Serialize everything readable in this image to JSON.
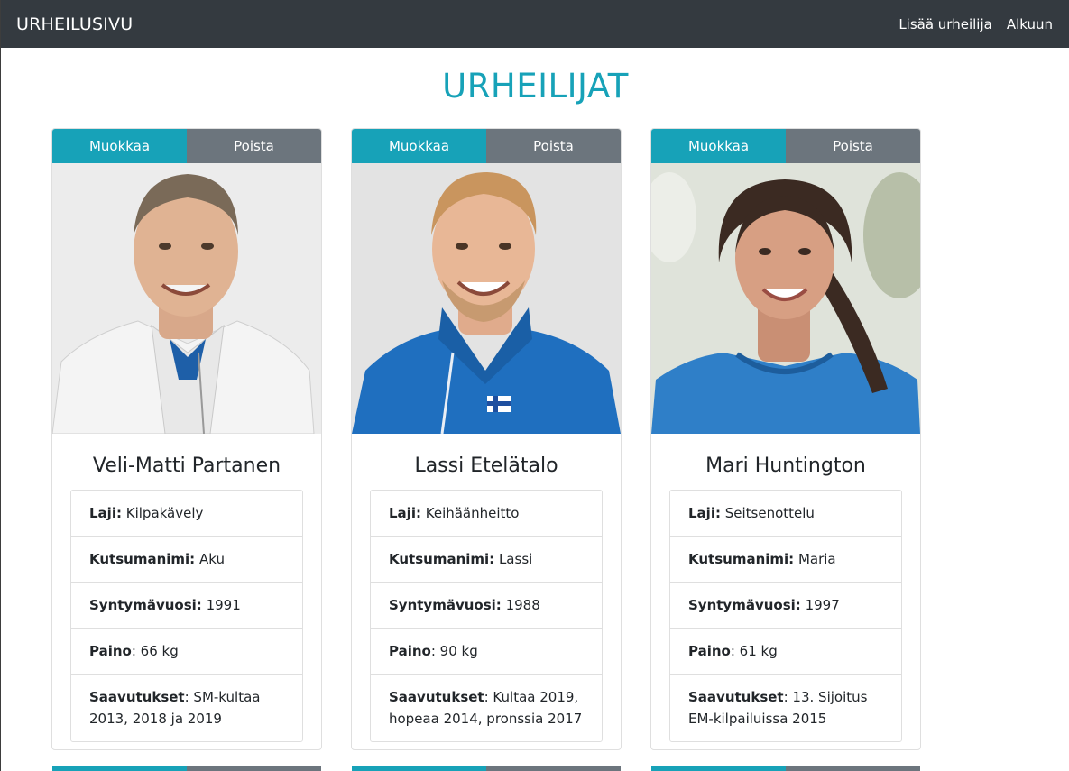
{
  "navbar": {
    "brand": "URHEILUSIVU",
    "links": [
      "Lisää urheilija",
      "Alkuun"
    ]
  },
  "page_title": "URHEILIJAT",
  "athletes": [
    {
      "edit_label": "Muokkaa",
      "delete_label": "Poista",
      "name": "Veli-Matti Partanen",
      "laji_label": "Laji:",
      "laji": "Kilpakävely",
      "kutsumanimi_label": "Kutsumanimi:",
      "kutsumanimi": "Aku",
      "syntymavuosi_label": "Syntymävuosi:",
      "syntymavuosi": "1991",
      "paino_label": "Paino",
      "paino": ": 66 kg",
      "saavutukset_label": "Saavutukset",
      "saavutukset": ": SM-kultaa 2013, 2018 ja 2019"
    },
    {
      "edit_label": "Muokkaa",
      "delete_label": "Poista",
      "name": "Lassi Etelätalo",
      "laji_label": "Laji:",
      "laji": "Keihäänheitto",
      "kutsumanimi_label": "Kutsumanimi:",
      "kutsumanimi": "Lassi",
      "syntymavuosi_label": "Syntymävuosi:",
      "syntymavuosi": "1988",
      "paino_label": "Paino",
      "paino": ": 90 kg",
      "saavutukset_label": "Saavutukset",
      "saavutukset": ": Kultaa 2019, hopeaa 2014, pronssia 2017"
    },
    {
      "edit_label": "Muokkaa",
      "delete_label": "Poista",
      "name": "Mari Huntington",
      "laji_label": "Laji:",
      "laji": "Seitsenottelu",
      "kutsumanimi_label": "Kutsumanimi:",
      "kutsumanimi": "Maria",
      "syntymavuosi_label": "Syntymävuosi:",
      "syntymavuosi": "1997",
      "paino_label": "Paino",
      "paino": ": 61 kg",
      "saavutukset_label": "Saavutukset",
      "saavutukset": ": 13. Sijoitus EM-kilpailuissa 2015"
    }
  ],
  "colors": {
    "navbar_bg": "#343a40",
    "accent": "#17a2b8",
    "secondary": "#6c757d"
  }
}
